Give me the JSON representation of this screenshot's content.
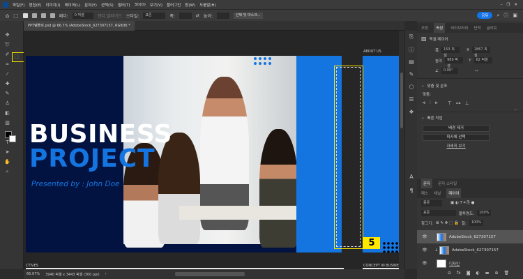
{
  "menubar": {
    "items": [
      "파일(F)",
      "편집(E)",
      "이미지(I)",
      "레이어(L)",
      "문자(Y)",
      "선택(S)",
      "필터(T)",
      "3D(D)",
      "보기(V)",
      "플러그인",
      "창(W)",
      "도움말(H)"
    ]
  },
  "options": {
    "feather_label": "페더:",
    "feather_value": "0 픽셀",
    "antialias_label": "앤티 앨리어스",
    "style_label": "스타일:",
    "style_value": "표준",
    "width_label": "폭:",
    "height_label": "높이:",
    "select_mask": "선택 및 마스크...",
    "share": "공유"
  },
  "document": {
    "tab_title": "PPT템플릿.psd @ 66.7% (AdobeStock_627307157, RGB/8) *",
    "zoom": "66.67%",
    "size": "3940 픽셀 x 3443 픽셀 (300 ppi)"
  },
  "canvas": {
    "title_line1": "BUSINESS",
    "title_line2": "PROJECT",
    "presenter": "Presented by : John Doe",
    "artboard_label_top": "ABOUT US",
    "artboard_label_left": "CTIVES",
    "artboard_label_right": "CONCEPT IN BUSINE",
    "step_badge": "5"
  },
  "colors": {
    "brand_blue": "#1475e1",
    "navy": "#031341",
    "highlight": "#ffe800"
  },
  "properties": {
    "tabs": [
      "조정",
      "속성",
      "라이브러리",
      "단락",
      "글리프"
    ],
    "active_tab": "속성",
    "layer_type": "픽셀 레이어",
    "w_label": "폭",
    "w_value": "153 픽셀",
    "x_label": "X",
    "x_value": "1867 픽셀",
    "h_label": "높이",
    "h_value": "989 픽셀",
    "y_label": "Y",
    "y_value": "62 픽셀",
    "angle_value": "0.00°",
    "align_section": "맞춤 및 분포",
    "align_label": "맞춤:",
    "more": "...",
    "quick_section": "빠른 작업",
    "remove_bg": "배경 제거",
    "select_subject": "피사체 선택",
    "view_more": "자세히 보기"
  },
  "layers_panel": {
    "top_tabs": [
      "문자",
      "문자 스타일"
    ],
    "tabs": [
      "패스",
      "채널",
      "레이어"
    ],
    "active_tab": "레이어",
    "filter": "종류",
    "blend": "표준",
    "opacity_label": "불투명도:",
    "opacity": "100%",
    "lock_label": "잠그기:",
    "fill_label": "칠:",
    "fill": "100%",
    "layers": [
      {
        "name": "AdobeStock_627307157",
        "selected": true
      },
      {
        "name": "AdobeStock_627307157",
        "selected": false
      },
      {
        "name": "디자인",
        "selected": false
      }
    ]
  }
}
